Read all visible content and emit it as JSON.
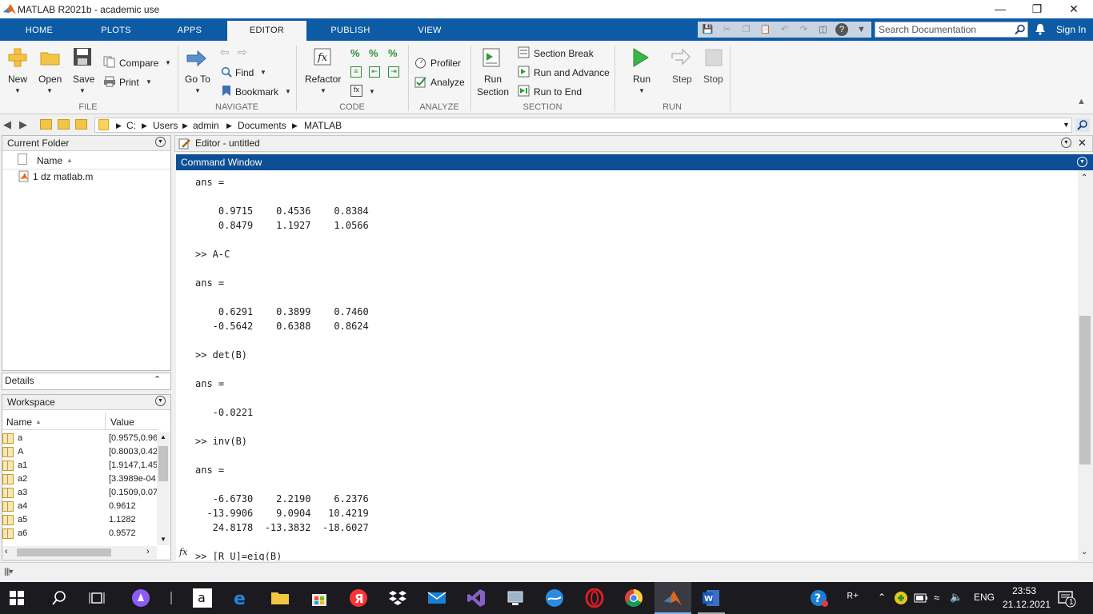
{
  "window": {
    "title": "MATLAB R2021b - academic use"
  },
  "tabs": [
    {
      "label": "HOME"
    },
    {
      "label": "PLOTS"
    },
    {
      "label": "APPS"
    },
    {
      "label": "EDITOR"
    },
    {
      "label": "PUBLISH"
    },
    {
      "label": "VIEW"
    }
  ],
  "search": {
    "placeholder": "Search Documentation"
  },
  "signin": "Sign In",
  "ribbon": {
    "file": {
      "group": "FILE",
      "new": "New",
      "open": "Open",
      "save": "Save",
      "compare": "Compare",
      "print": "Print"
    },
    "navigate": {
      "group": "NAVIGATE",
      "goto": "Go To",
      "find": "Find",
      "bookmark": "Bookmark"
    },
    "code": {
      "group": "CODE",
      "refactor": "Refactor"
    },
    "analyze": {
      "group": "ANALYZE",
      "profiler": "Profiler",
      "analyze": "Analyze"
    },
    "section": {
      "group": "SECTION",
      "run_section_1": "Run",
      "run_section_2": "Section",
      "section_break": "Section Break",
      "run_advance": "Run and Advance",
      "run_end": "Run to End"
    },
    "run": {
      "group": "RUN",
      "run": "Run",
      "step": "Step",
      "stop": "Stop"
    }
  },
  "path": [
    "C:",
    "Users",
    "admin",
    "Documents",
    "MATLAB"
  ],
  "current_folder": {
    "title": "Current Folder",
    "column": "Name",
    "files": [
      "1 dz matlab.m"
    ]
  },
  "details": {
    "title": "Details"
  },
  "workspace": {
    "title": "Workspace",
    "columns": [
      "Name",
      "Value"
    ],
    "rows": [
      {
        "name": "a",
        "value": "[0.9575,0.96"
      },
      {
        "name": "A",
        "value": "[0.8003,0.42"
      },
      {
        "name": "a1",
        "value": "[1.9147,1.45"
      },
      {
        "name": "a2",
        "value": "[3.3989e-04"
      },
      {
        "name": "a3",
        "value": "[0.1509,0.07"
      },
      {
        "name": "a4",
        "value": "0.9612"
      },
      {
        "name": "a5",
        "value": "1.1282"
      },
      {
        "name": "a6",
        "value": "0.9572"
      }
    ]
  },
  "editor": {
    "title": "Editor - untitled"
  },
  "command_window": {
    "title": "Command Window",
    "lines": [
      "ans =",
      "",
      "    0.9715    0.4536    0.8384",
      "    0.8479    1.1927    1.0566",
      "",
      ">> A-C",
      "",
      "ans =",
      "",
      "    0.6291    0.3899    0.7460",
      "   -0.5642    0.6388    0.8624",
      "",
      ">> det(B)",
      "",
      "ans =",
      "",
      "   -0.0221",
      "",
      ">> inv(B)",
      "",
      "ans =",
      "",
      "   -6.6730    2.2190    6.2376",
      "  -13.9906    9.0904   10.4219",
      "   24.8178  -13.3832  -18.6027",
      "",
      ">> [R U]=eig(B)"
    ],
    "prompt_icon": "fx"
  },
  "taskbar": {
    "lang": "ENG",
    "time": "23:53",
    "date": "21.12.2021",
    "notifications": "1"
  }
}
